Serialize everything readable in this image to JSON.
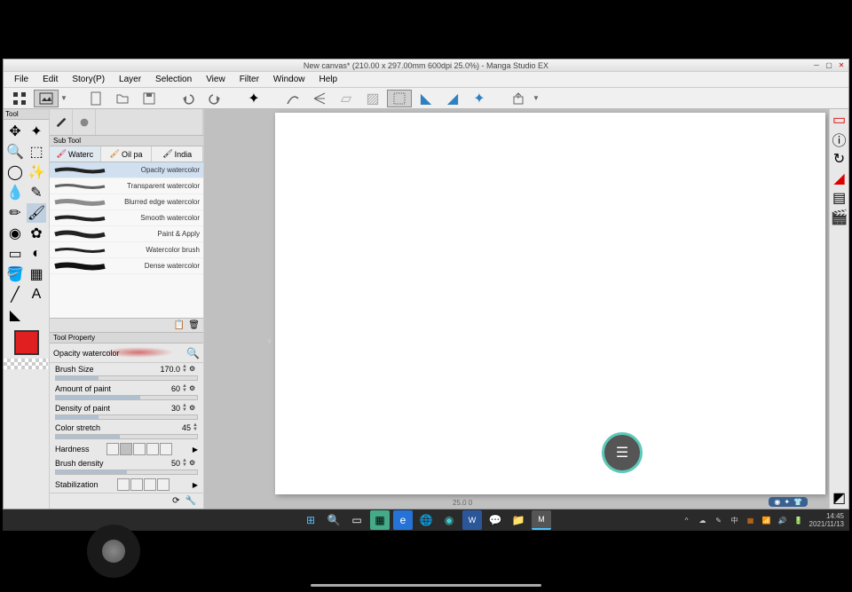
{
  "window": {
    "title": "New canvas* (210.00 x 297.00mm 600dpi 25.0%) - Manga Studio EX"
  },
  "menu": {
    "file": "File",
    "edit": "Edit",
    "story": "Story(P)",
    "layer": "Layer",
    "selection": "Selection",
    "view": "View",
    "filter": "Filter",
    "window": "Window",
    "help": "Help"
  },
  "subtool": {
    "title": "Sub Tool",
    "tool_label": "Tool",
    "tabs": [
      "Waterc",
      "Oil pa",
      "India"
    ],
    "brushes": [
      "Opacity watercolor",
      "Transparent watercolor",
      "Blurred edge watercolor",
      "Smooth watercolor",
      "Paint & Apply",
      "Watercolor brush",
      "Dense watercolor"
    ]
  },
  "property": {
    "title": "Tool Property",
    "current": "Opacity watercolor",
    "brush_size_label": "Brush Size",
    "brush_size": "170.0",
    "amount_label": "Amount of paint",
    "amount": "60",
    "density_label": "Density of paint",
    "density": "30",
    "stretch_label": "Color stretch",
    "stretch": "45",
    "hardness_label": "Hardness",
    "brush_density_label": "Brush density",
    "brush_density": "50",
    "stabilization_label": "Stabilization"
  },
  "canvas": {
    "zoom": "25.0 0"
  },
  "colors": {
    "foreground": "#e02020"
  },
  "taskbar": {
    "time": "14:45",
    "date": "2021/11/13"
  }
}
